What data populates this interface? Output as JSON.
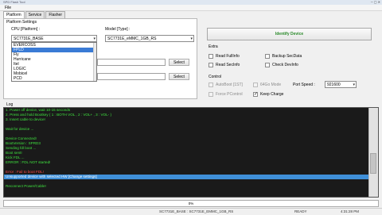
{
  "window": {
    "title": "SPD Flash Tool",
    "controls": "─  ▢  ✕"
  },
  "menu": {
    "file": "File"
  },
  "tabs": [
    "Platform",
    "Service",
    "Flasher"
  ],
  "platform_settings": {
    "title": "Platform Settings",
    "cpu_label": "CPU [Platform] :",
    "cpu_value": "SC7731E_BASE",
    "model_label": "Model [Type] :",
    "model_value": "SC7731E_eMMC_1GB_RS",
    "dropdown_items": [
      "EVERCOSS",
      "FPLD",
      "Fly",
      "Hurricane",
      "Itel",
      "LOGIC",
      "Mobicel",
      "PCD"
    ],
    "dropdown_selected_index": 1,
    "select_button": "Select"
  },
  "identify_button": "Identify Device",
  "extra": {
    "title": "Extra",
    "read_fullinfo": "Read FullInfo",
    "backup_secdata": "Backup SecData",
    "read_secinfo": "Read SecInfo",
    "check_devinfo": "Check DevInfo"
  },
  "control": {
    "title": "Control",
    "autoboot": "AutoBoot [1ST]",
    "mode_64": "64Go Mode",
    "force_pcontrol": "Force PControl",
    "keep_charge": "Keep Charge",
    "keep_charge_checked": true,
    "port_speed_label": "Port Speed :",
    "port_speed_value": "921600"
  },
  "log": {
    "label": "Log",
    "lines": [
      {
        "text": "1. Power off device, wait 10-15 seconds",
        "color": "g"
      },
      {
        "text": "2. Press and hold Bootkey ( 1 : BOTH VOL , 2 : VOL+ , 3 : VOL- )",
        "color": "g"
      },
      {
        "text": "3. Insert cable to device!",
        "color": "g"
      },
      {
        "text": "",
        "color": "g"
      },
      {
        "text": "Wait for device ...",
        "color": "g"
      },
      {
        "text": "",
        "color": "g"
      },
      {
        "text": "Device Connected!",
        "color": "g"
      },
      {
        "text": "BootVersion : SPRD3",
        "color": "g"
      },
      {
        "text": "Sending fdl boot ...",
        "color": "g"
      },
      {
        "text": "Boot sent!",
        "color": "g"
      },
      {
        "text": "Kick FDL ...",
        "color": "g"
      },
      {
        "text": "ERROR : FDL NOT started!",
        "color": "g"
      },
      {
        "text": "",
        "color": "g"
      },
      {
        "text": "Error : Fail to boot FDL!",
        "color": "r"
      },
      {
        "text": "Unsupported device with selected HW [Change settings]",
        "color": "hl"
      },
      {
        "text": "",
        "color": "g"
      },
      {
        "text": "Reconnect Power/Cable!",
        "color": "g"
      }
    ]
  },
  "progress": {
    "text": "0%",
    "value_percent": 0
  },
  "status": {
    "platform": "SC7731E_BASE : SC7731E_EMMC_1GB_RS",
    "state": "READY"
  },
  "taskbar": {
    "time": "4:31:28 PM"
  }
}
